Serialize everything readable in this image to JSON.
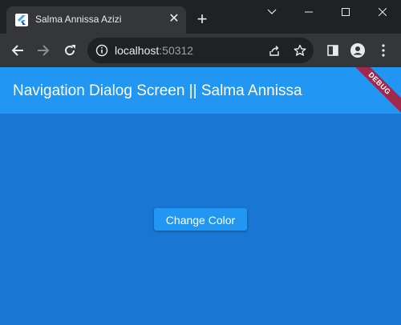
{
  "browser": {
    "tab": {
      "title": "Salma Annissa Azizi",
      "favicon": "flutter-icon"
    },
    "url": {
      "host": "localhost",
      "port": ":50312"
    },
    "colors": {
      "tabstrip": "#202124",
      "toolbar": "#35363a"
    }
  },
  "app": {
    "appbar": {
      "title": "Navigation Dialog Screen || Salma Annissa"
    },
    "debug_banner": "DEBUG",
    "button": {
      "label": "Change Color"
    },
    "colors": {
      "appbar": "#2196f3",
      "body": "#1976d2",
      "button": "#2196f3"
    }
  }
}
